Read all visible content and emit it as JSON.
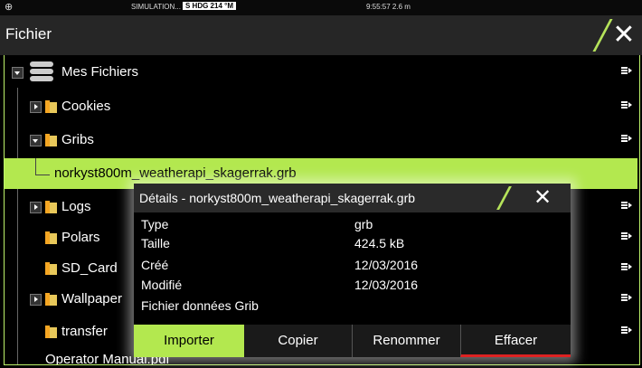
{
  "status": {
    "globe_icon": "globe-icon",
    "simulation": "SIMULATION...",
    "heading": "S HDG 214 °M",
    "time": "9:55:57  2.6 m"
  },
  "window": {
    "title": "Fichier",
    "close_icon": "close-icon",
    "accent": "#b5e35a"
  },
  "tree": {
    "root": {
      "label": "Mes Fichiers",
      "icon": "database-icon"
    },
    "items": [
      {
        "label": "Cookies",
        "icon": "folder-icon",
        "expander": "collapsed"
      },
      {
        "label": "Gribs",
        "icon": "folder-icon",
        "expander": "expanded"
      },
      {
        "label": "norkyst800m_weatherapi_skagerrak.grb",
        "selected": true
      },
      {
        "label": "Logs",
        "icon": "folder-icon",
        "expander": "collapsed"
      },
      {
        "label": "Polars",
        "icon": "folder-icon"
      },
      {
        "label": "SD_Card",
        "icon": "folder-icon"
      },
      {
        "label": "Wallpaper",
        "icon": "folder-icon",
        "expander": "collapsed"
      },
      {
        "label": "transfer",
        "icon": "folder-icon"
      },
      {
        "label": "Operator Manual.pdf"
      }
    ],
    "menu_icon": "row-menu-icon"
  },
  "dialog": {
    "title": "Détails - norkyst800m_weatherapi_skagerrak.grb",
    "rows": [
      {
        "label": "Type",
        "value": "grb"
      },
      {
        "label": "Taille",
        "value": "424.5 kB"
      },
      {
        "label": "Créé",
        "value": "12/03/2016"
      },
      {
        "label": "Modifié",
        "value": "12/03/2016"
      }
    ],
    "description": "Fichier données Grib",
    "buttons": {
      "import": "Importer",
      "copy": "Copier",
      "rename": "Renommer",
      "delete": "Effacer"
    }
  },
  "colors": {
    "highlight": "#b3e84f",
    "delete_underline": "#dd2222",
    "folder": "#f5a623"
  }
}
